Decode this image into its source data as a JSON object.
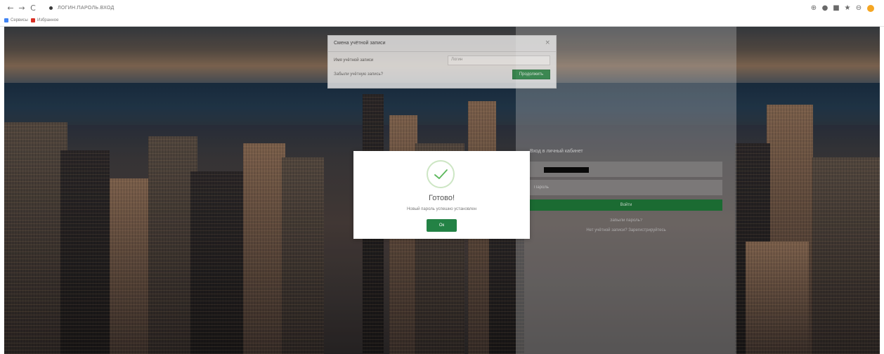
{
  "browser": {
    "back_glyph": "←",
    "forward_glyph": "→",
    "reload_glyph": "C",
    "lock_icon": "lock-icon",
    "url": "ЛОГИН.ПАРОЛЬ.ВХОД",
    "toolbar_icons": [
      "translate-icon",
      "zoom-icon",
      "extension-icon",
      "star-icon",
      "account-icon",
      "profile-icon"
    ],
    "bookmarks": [
      {
        "label": "Сервисы",
        "color": "#4285f4"
      },
      {
        "label": "Избранное",
        "color": "#d93025"
      }
    ]
  },
  "background_dialog": {
    "title": "Смена учётной записи",
    "close_glyph": "×",
    "field_label": "Имя учётной записи",
    "field_placeholder": "Логин",
    "link": "Забыли учётную запись?",
    "button": "Продолжить"
  },
  "login_panel": {
    "title": "Вход в личный кабинет",
    "password_placeholder": "Пароль",
    "submit": "Войти",
    "link_forgot": "Забыли пароль?",
    "link_register": "Нет учётной записи? Зарегистрируйтесь"
  },
  "modal": {
    "icon": "check-icon",
    "title": "Готово!",
    "message": "Новый пароль успешно установлен",
    "ok_label": "Ок"
  },
  "colors": {
    "accent_green": "#238245",
    "check_green": "#5cb85c"
  }
}
